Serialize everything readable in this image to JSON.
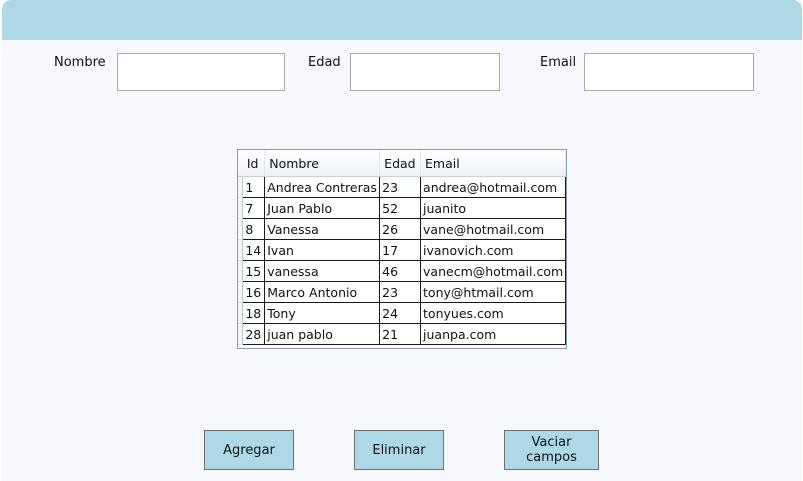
{
  "form": {
    "nombre_label": "Nombre",
    "edad_label": "Edad",
    "email_label": "Email",
    "nombre_value": "",
    "edad_value": "",
    "email_value": ""
  },
  "table": {
    "columns": [
      "Id",
      "Nombre",
      "Edad",
      "Email"
    ],
    "rows": [
      [
        "1",
        "Andrea Contreras",
        "23",
        "andrea@hotmail.com"
      ],
      [
        "7",
        "Juan Pablo",
        "52",
        "juanito"
      ],
      [
        "8",
        "Vanessa",
        "26",
        "vane@hotmail.com"
      ],
      [
        "14",
        "Ivan",
        "17",
        "ivanovich.com"
      ],
      [
        "15",
        "vanessa",
        "46",
        "vanecm@hotmail.com"
      ],
      [
        "16",
        "Marco Antonio",
        "23",
        "tony@htmail.com"
      ],
      [
        "18",
        "Tony",
        "24",
        "tonyues.com"
      ],
      [
        "28",
        "juan pablo",
        "21",
        "juanpa.com"
      ]
    ]
  },
  "buttons": {
    "agregar": "Agregar",
    "eliminar": "Eliminar",
    "vaciar": "Vaciar campos"
  },
  "colors": {
    "title_bar": "#add8e6",
    "background": "#f7f8fd",
    "button": "#add8e6"
  }
}
